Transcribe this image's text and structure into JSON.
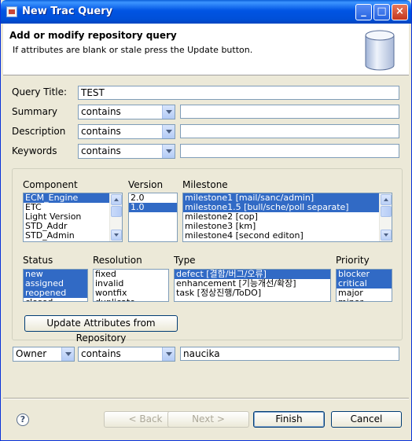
{
  "window": {
    "title": "New Trac Query"
  },
  "header": {
    "title": "Add or modify repository query",
    "message": "If attributes are blank or stale press the Update button."
  },
  "form": {
    "query_title_label": "Query Title:",
    "query_title_value": "TEST",
    "rows": [
      {
        "label": "Summary",
        "operator": "contains",
        "value": ""
      },
      {
        "label": "Description",
        "operator": "contains",
        "value": ""
      },
      {
        "label": "Keywords",
        "operator": "contains",
        "value": ""
      }
    ]
  },
  "attributes": {
    "component": {
      "label": "Component",
      "items": [
        "ECM_Engine",
        "ETC",
        "Light Version",
        "STD_Addr",
        "STD_Admin"
      ],
      "selected": [
        0
      ]
    },
    "version": {
      "label": "Version",
      "items": [
        "2.0",
        "1.0"
      ],
      "selected": [
        1
      ]
    },
    "milestone": {
      "label": "Milestone",
      "items": [
        "milestone1 [mail/sanc/admin]",
        "milestone1.5 [bull/sche/poll separate]",
        "milestone2 [cop]",
        "milestone3 [km]",
        "milestone4 [second editon]"
      ],
      "selected": [
        0,
        1
      ]
    },
    "status": {
      "label": "Status",
      "items": [
        "new",
        "assigned",
        "reopened",
        "closed"
      ],
      "selected": [
        0,
        1,
        2
      ]
    },
    "resolution": {
      "label": "Resolution",
      "items": [
        "fixed",
        "invalid",
        "wontfix",
        "duplicate"
      ],
      "selected": []
    },
    "type": {
      "label": "Type",
      "items": [
        "defect [결함/버그/오류]",
        "enhancement [기능개선/확장]",
        "task [정상진행/ToDO]"
      ],
      "selected": [
        0
      ]
    },
    "priority": {
      "label": "Priority",
      "items": [
        "blocker",
        "critical",
        "major",
        "minor"
      ],
      "selected": [
        0,
        1
      ]
    }
  },
  "update_button": "Update Attributes from Repository",
  "owner_row": {
    "field": "Owner",
    "operator": "contains",
    "value": "naucika"
  },
  "buttons": {
    "back": "< Back",
    "next": "Next >",
    "finish": "Finish",
    "cancel": "Cancel"
  },
  "colors": {
    "selection": "#316ac5",
    "titlebar": "#0054e3",
    "face": "#ece9d8"
  }
}
